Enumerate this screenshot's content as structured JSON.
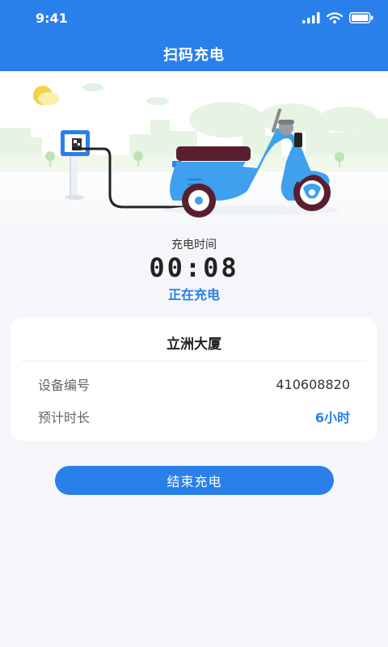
{
  "status_bar": {
    "time": "9:41"
  },
  "header": {
    "title": "扫码充电"
  },
  "charging": {
    "time_label": "充电时间",
    "elapsed": "00:08",
    "status": "正在充电"
  },
  "station": {
    "name": "立洲大厦",
    "rows": [
      {
        "label": "设备编号",
        "value": "410608820"
      },
      {
        "label": "预计时长",
        "value": "6小时"
      }
    ]
  },
  "actions": {
    "end_label": "结束充电"
  },
  "colors": {
    "primary": "#2a80ea",
    "scooter": "#3ea0ee",
    "background": "#f4f6f9"
  }
}
